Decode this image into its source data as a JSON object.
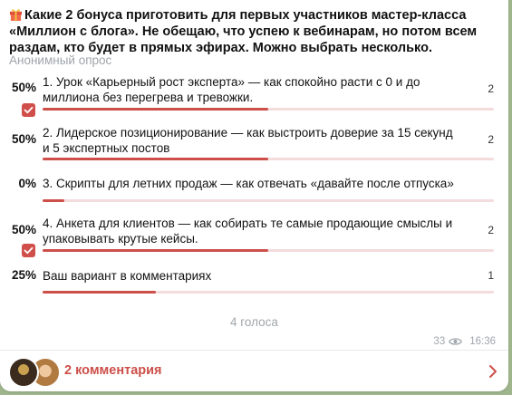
{
  "poll": {
    "question": "Какие 2 бонуса приготовить для первых участников мастер-класса «Миллион с блога». Не обещаю, что успею к вебинарам, но потом всем раздам, кто будет в прямых эфирах. Можно выбрать несколько.",
    "type_label": "Анонимный опрос",
    "options": [
      {
        "percent": "50%",
        "text": "1. Урок «Карьерный рост эксперта» — как спокойно расти с 0 и до миллиона без перегрева и тревожки.",
        "votes": "2",
        "share": 0.5,
        "chosen": true
      },
      {
        "percent": "50%",
        "text": "2. Лидерское позиционирование — как выстроить доверие за 15 секунд и 5 экспертных постов",
        "votes": "2",
        "share": 0.5,
        "chosen": false
      },
      {
        "percent": "0%",
        "text": "3. Скрипты для летних продаж — как отвечать «давайте после отпуска»",
        "votes": "",
        "share": 0,
        "chosen": false
      },
      {
        "percent": "50%",
        "text": "4. Анкета для клиентов — как собирать те самые продающие смыслы и упаковывать крутые кейсы.",
        "votes": "2",
        "share": 0.5,
        "chosen": true
      },
      {
        "percent": "25%",
        "text": "Ваш вариант в комментариях",
        "votes": "1",
        "share": 0.25,
        "chosen": false
      }
    ],
    "total_votes": "4 голоса",
    "views": "33",
    "time": "16:36"
  },
  "comments": {
    "label": "2 комментария"
  },
  "colors": {
    "accent": "#cc4f49",
    "track": "#f4dcdd",
    "muted": "#a0a6ab"
  }
}
